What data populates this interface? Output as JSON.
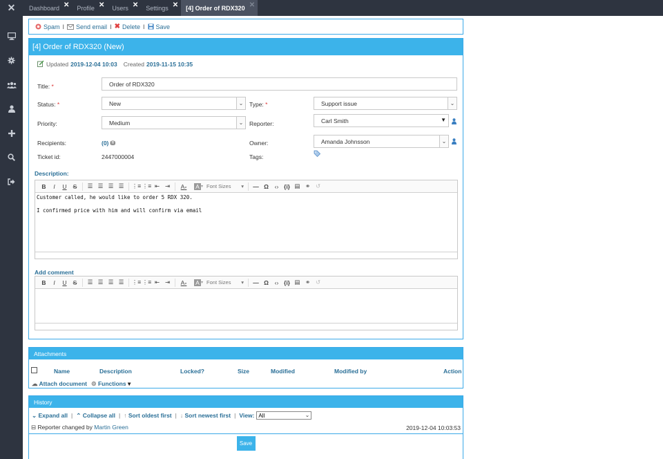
{
  "logo": "✕",
  "tabs": [
    {
      "label": "Dashboard"
    },
    {
      "label": "Profile"
    },
    {
      "label": "Users"
    },
    {
      "label": "Settings"
    },
    {
      "label": "[4] Order of RDX320"
    }
  ],
  "sidebar": {
    "icons": [
      "monitor-icon",
      "gear-icon",
      "users-icon",
      "user-icon",
      "plus-icon",
      "search-icon",
      "logout-icon"
    ]
  },
  "actions": {
    "spam": "Spam",
    "send_email": "Send email",
    "delete": "Delete",
    "save": "Save",
    "sep": "I"
  },
  "ticket": {
    "header": "[4] Order of RDX320 (New)",
    "updated_label": "Updated",
    "updated_value": "2019-12-04 10:03",
    "created_label": "Created",
    "created_value": "2019-11-15 10:35",
    "title_label": "Title:",
    "title_value": "Order of RDX320",
    "status_label": "Status:",
    "status_value": "New",
    "type_label": "Type:",
    "type_value": "Support issue",
    "priority_label": "Priority:",
    "priority_value": "Medium",
    "reporter_label": "Reporter:",
    "reporter_value": "Carl Smith",
    "recipients_label": "Recipients:",
    "recipients_value": "(0)",
    "owner_label": "Owner:",
    "owner_value": "Amanda Johnsson",
    "ticket_id_label": "Ticket id:",
    "ticket_id_value": "2447000004",
    "tags_label": "Tags:",
    "required_mark": "*"
  },
  "description": {
    "label": "Description:",
    "line1": "Customer called, he would like to order 5 RDX 320.",
    "line2": "I confirmed price with him and will confirm via email"
  },
  "comment": {
    "label": "Add comment"
  },
  "toolbar": {
    "bold": "B",
    "italic": "I",
    "underline": "U",
    "strike": "S",
    "font_sizes": "Font Sizes",
    "omega": "Ω",
    "code": "‹›",
    "var": "{i}",
    "hr": "—",
    "caret": "▾",
    "text_a": "A"
  },
  "attachments": {
    "title": "Attachments",
    "columns": {
      "name": "Name",
      "description": "Description",
      "locked": "Locked?",
      "size": "Size",
      "modified": "Modified",
      "modified_by": "Modified by",
      "action": "Action"
    },
    "attach_document": "Attach document",
    "functions": "Functions"
  },
  "history": {
    "title": "History",
    "expand_all": "Expand all",
    "collapse_all": "Collapse all",
    "sort_oldest": "Sort oldest first",
    "sort_newest": "Sort newest first",
    "view_label": "View:",
    "view_value": "All",
    "entry_text": "Reporter changed by",
    "entry_user": "Martin Green",
    "entry_time": "2019-12-04 10:03:53",
    "pipe": "|",
    "toggle": "⊟"
  },
  "save_button": "Save"
}
